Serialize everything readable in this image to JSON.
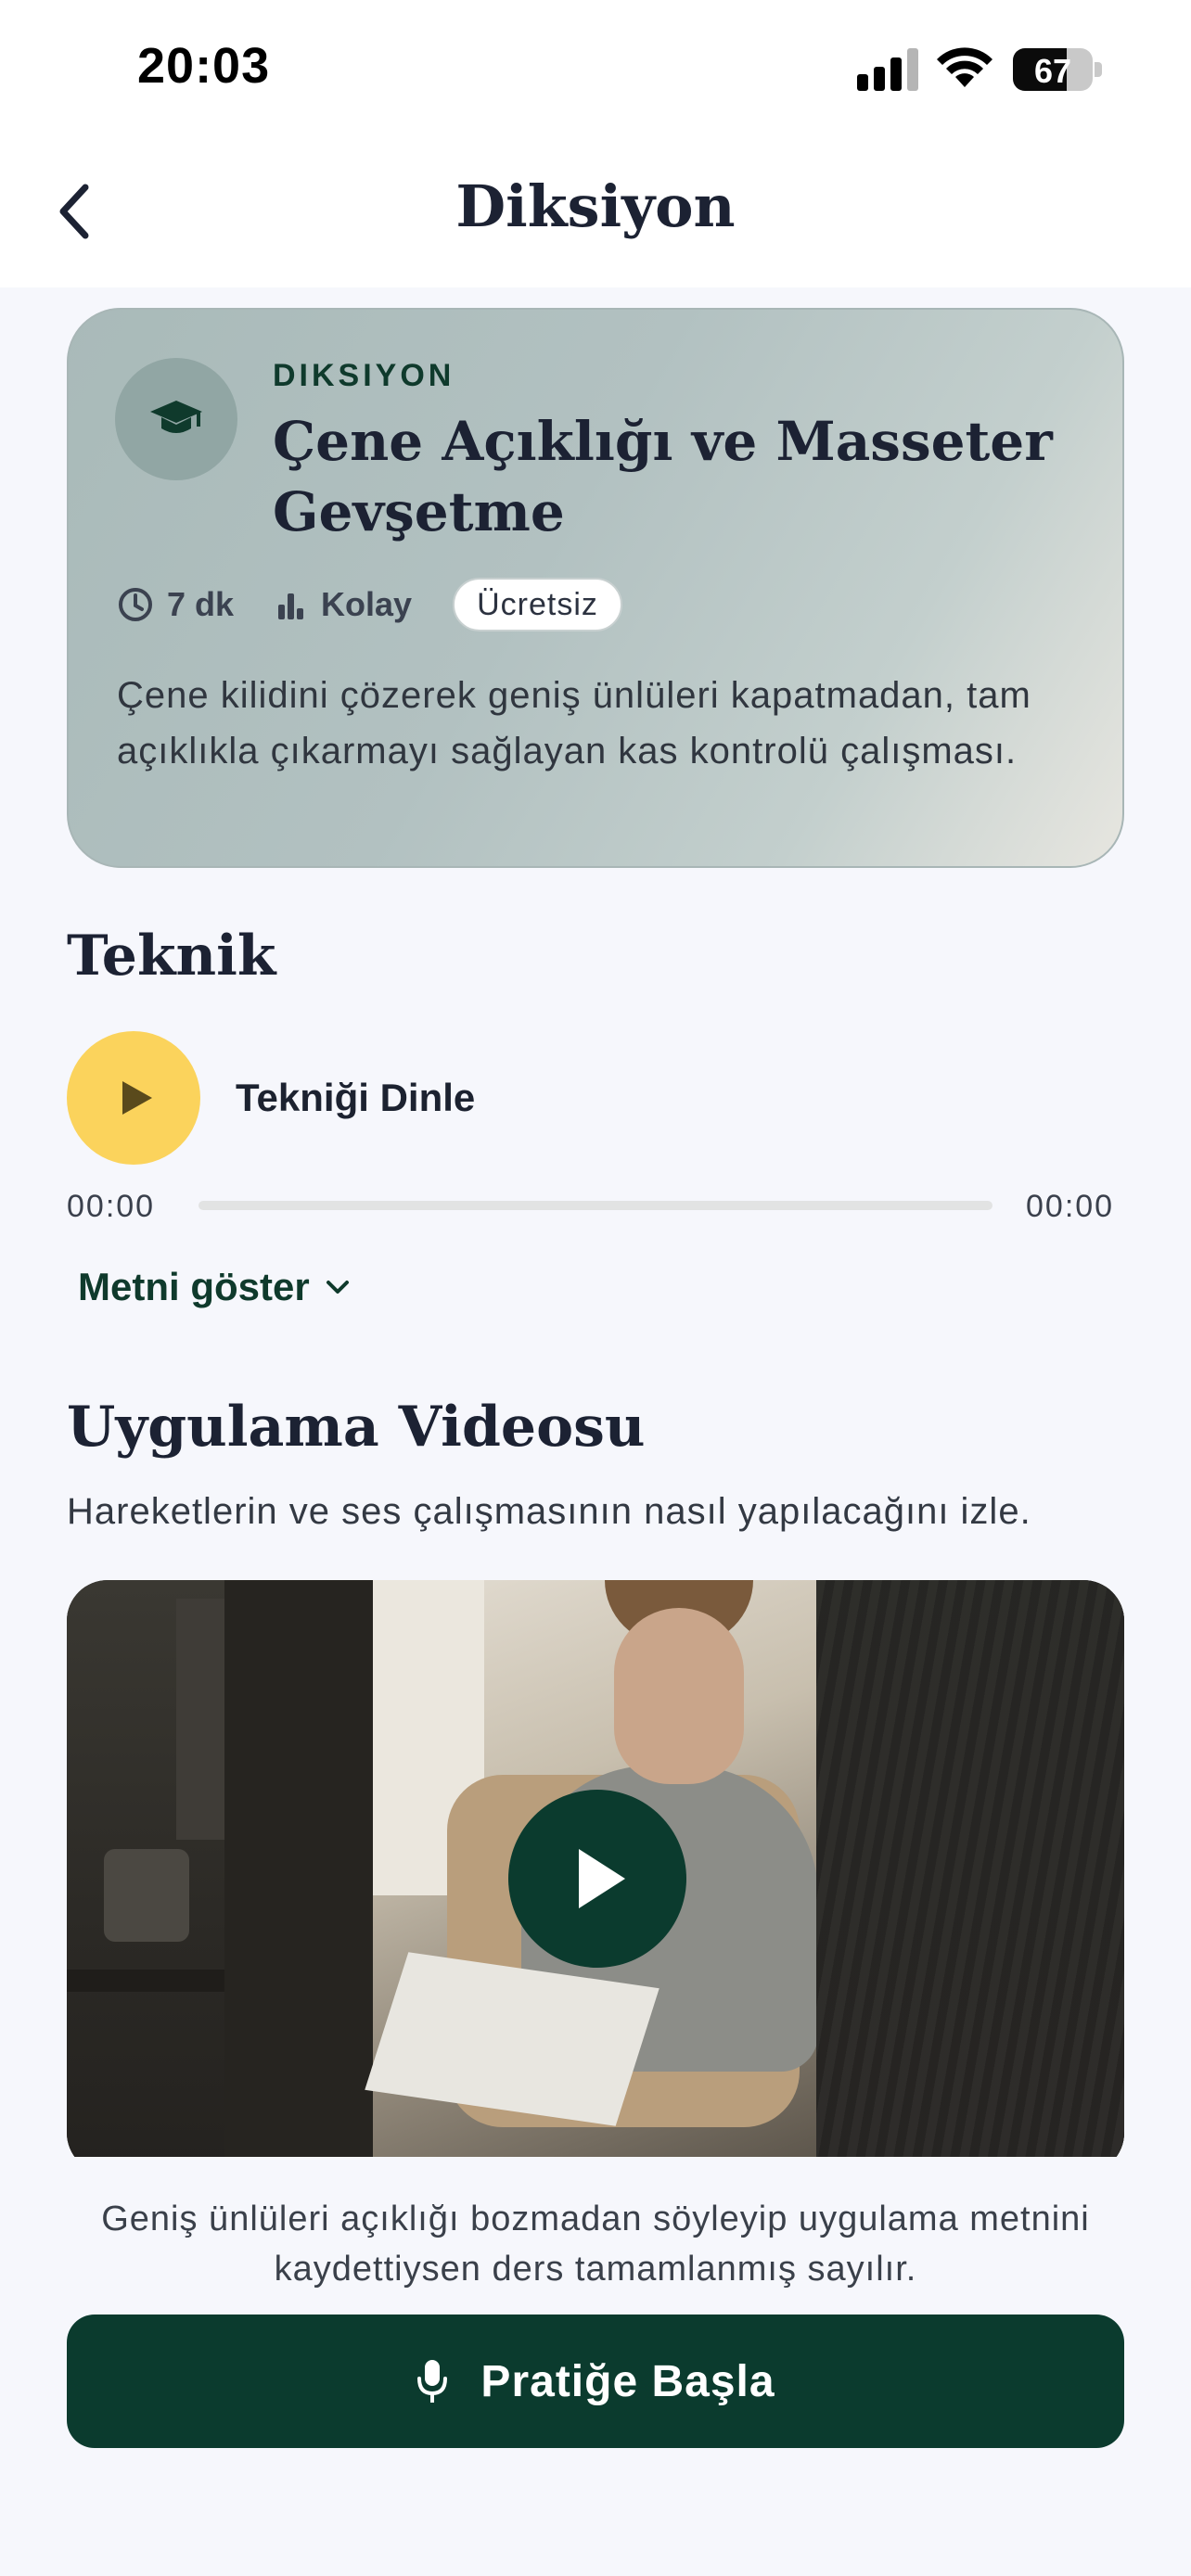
{
  "status_bar": {
    "time": "20:03",
    "battery": "67",
    "battery_level_pct": 67
  },
  "nav": {
    "title": "Diksiyon",
    "back_icon": "chevron-left-icon"
  },
  "hero": {
    "icon": "graduation-cap-icon",
    "category": "DIKSIYON",
    "title": "Çene Açıklığı ve Masseter Gevşetme",
    "duration": "7 dk",
    "level": "Kolay",
    "price_badge": "Ücretsiz",
    "description": "Çene kilidini çözerek geniş ünlüleri kapatmadan, tam açıklıkla çıkarmayı sağlayan kas kontrolü çalışması."
  },
  "technique": {
    "title": "Teknik",
    "audio_label": "Tekniği Dinle",
    "time_elapsed": "00:00",
    "time_total": "00:00",
    "progress_pct": 0,
    "show_text": "Metni göster"
  },
  "video": {
    "title": "Uygulama Videosu",
    "subtitle": "Hareketlerin ve ses çalışmasının nasıl yapılacağını izle."
  },
  "footer": {
    "note": "Geniş ünlüleri açıklığı bozmadan söyleyip uygulama metnini kaydettiysen ders tamamlanmış sayılır.",
    "cta_label": "Pratiğe Başla",
    "cta_icon": "microphone-icon"
  },
  "colors": {
    "brand_dark_green": "#0b3b2e",
    "accent_yellow": "#fbd35c",
    "background": "#f6f7fc"
  }
}
